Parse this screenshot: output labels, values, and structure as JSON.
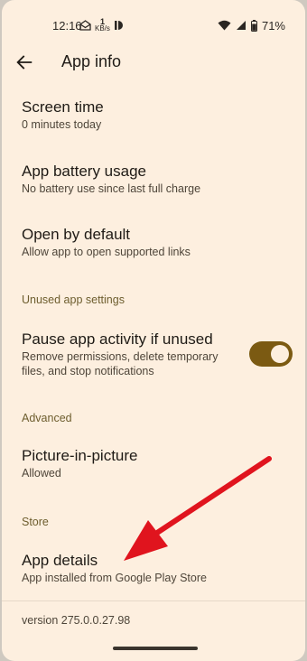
{
  "status": {
    "time": "12:16",
    "netspeed_value": "1",
    "netspeed_unit": "KB/s",
    "battery": "71%"
  },
  "header": {
    "title": "App info"
  },
  "items": [
    {
      "title": "Screen time",
      "subtitle": "0 minutes today"
    },
    {
      "title": "App battery usage",
      "subtitle": "No battery use since last full charge"
    },
    {
      "title": "Open by default",
      "subtitle": "Allow app to open supported links"
    }
  ],
  "unused": {
    "section_label": "Unused app settings",
    "title": "Pause app activity if unused",
    "subtitle_line1": "Remove permissions, delete temporary",
    "subtitle_line2": "files, and stop notifications",
    "toggle_on": true
  },
  "advanced": {
    "section_label": "Advanced",
    "title": "Picture-in-picture",
    "subtitle": "Allowed"
  },
  "store": {
    "section_label": "Store",
    "title": "App details",
    "subtitle": "App installed from Google Play Store"
  },
  "footer": {
    "version": "version 275.0.0.27.98"
  },
  "colors": {
    "background": "#fdefdf",
    "toggle_track": "#7b5a12",
    "section_label": "#6d5d2e",
    "annotation_arrow": "#e0141e"
  },
  "icons": {
    "back": "arrow-left-icon",
    "wifi": "wifi-icon",
    "signal": "signal-icon",
    "battery": "battery-icon"
  }
}
